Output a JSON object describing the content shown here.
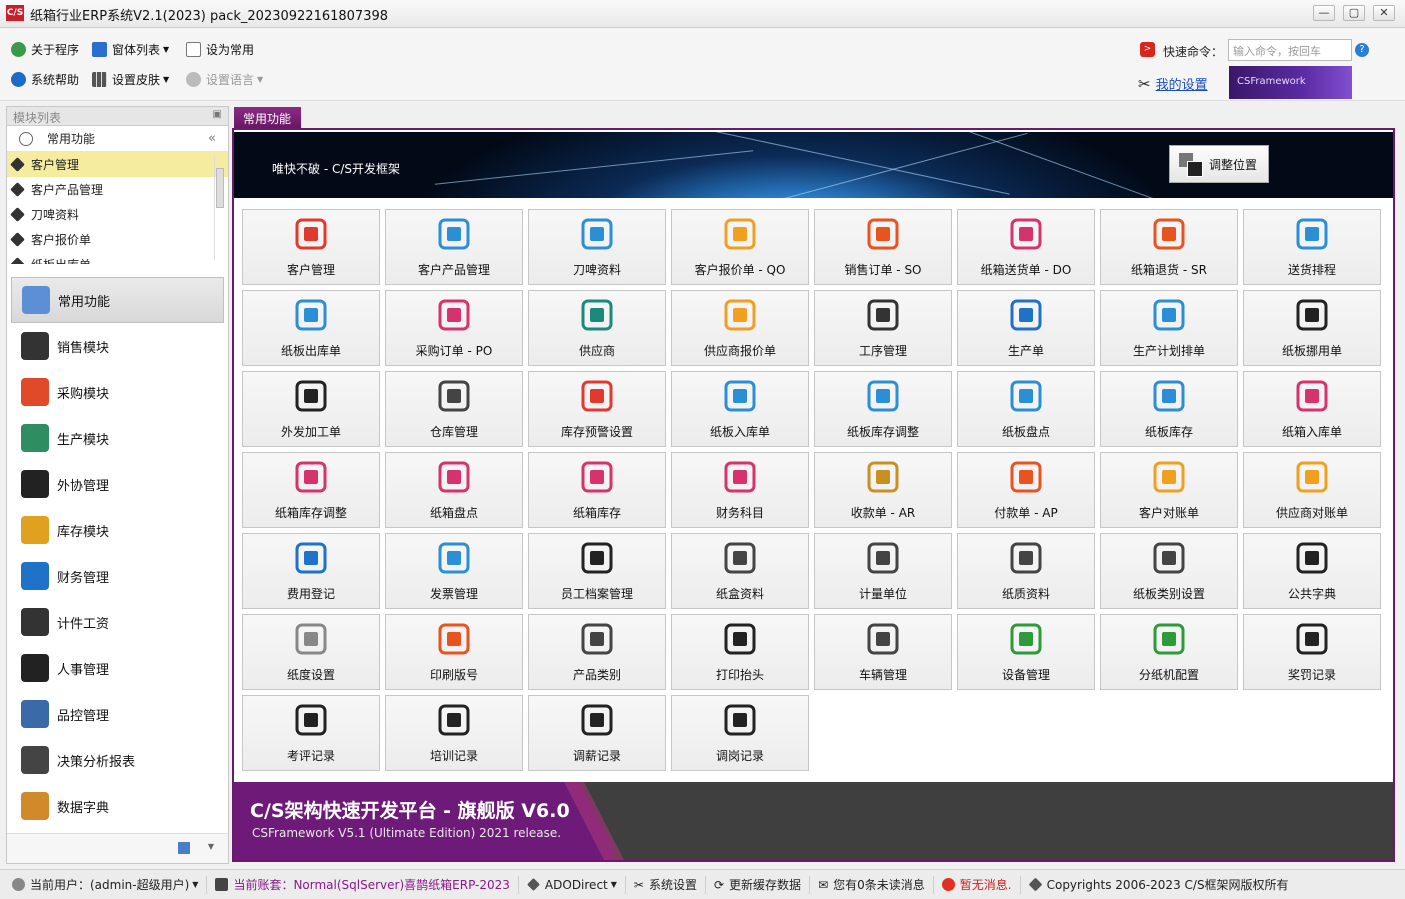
{
  "window": {
    "title": "纸箱行业ERP系统V2.1(2023) pack_20230922161807398",
    "logo": "C/S",
    "controls": {
      "minimize": "—",
      "restore": "▢",
      "close": "✕"
    }
  },
  "toolbar": {
    "about": "关于程序",
    "window_list": "窗体列表",
    "set_common": "设为常用",
    "help": "系统帮助",
    "skin": "设置皮肤",
    "language": "设置语言",
    "quick_command_label": "快速命令：",
    "quick_command_placeholder": "输入命令，按回车",
    "my_settings": "我的设置",
    "brand_banner": "CSFramework"
  },
  "left_panel": {
    "title": "模块列表",
    "common_header": "常用功能",
    "module_items": [
      "客户管理",
      "客户产品管理",
      "刀啤资料",
      "客户报价单",
      "纸板出库单"
    ],
    "selected_index": 0,
    "nav": [
      {
        "label": "常用功能",
        "icon": "user-icon",
        "color": "#5b8fd6"
      },
      {
        "label": "销售模块",
        "icon": "org-chart-icon",
        "color": "#333333"
      },
      {
        "label": "采购模块",
        "icon": "cart-icon",
        "color": "#e04a2a"
      },
      {
        "label": "生产模块",
        "icon": "money-chart-icon",
        "color": "#2f8d62"
      },
      {
        "label": "外协管理",
        "icon": "house-icon",
        "color": "#222222"
      },
      {
        "label": "库存模块",
        "icon": "coins-icon",
        "color": "#e0a020"
      },
      {
        "label": "财务管理",
        "icon": "windows-icon",
        "color": "#1e72c8"
      },
      {
        "label": "计件工资",
        "icon": "database-icon",
        "color": "#333333"
      },
      {
        "label": "人事管理",
        "icon": "tools-icon",
        "color": "#222222"
      },
      {
        "label": "品控管理",
        "icon": "spreadsheet-search-icon",
        "color": "#3a6aa8"
      },
      {
        "label": "决策分析报表",
        "icon": "grid-gear-icon",
        "color": "#444444"
      },
      {
        "label": "数据字典",
        "icon": "color-grid-icon",
        "color": "#d08a2a"
      }
    ]
  },
  "workspace": {
    "tab": "常用功能",
    "hero_text": "唯快不破 - C/S开发框架",
    "adjust_button": "调整位置",
    "tiles": [
      {
        "label": "客户管理",
        "icon": "users-icon",
        "color": "#e0392e"
      },
      {
        "label": "客户产品管理",
        "icon": "box-gear-icon",
        "color": "#2a8fd4"
      },
      {
        "label": "刀啤资料",
        "icon": "machine-icon",
        "color": "#2a8fd4"
      },
      {
        "label": "客户报价单 - QO",
        "icon": "dollar-doc-icon",
        "color": "#f0a020"
      },
      {
        "label": "销售订单 - SO",
        "icon": "clipboard-check-icon",
        "color": "#e8531e"
      },
      {
        "label": "纸箱送货单 - DO",
        "icon": "truck-icon",
        "color": "#d6336c"
      },
      {
        "label": "纸箱退货 - SR",
        "icon": "return-doc-icon",
        "color": "#e8531e"
      },
      {
        "label": "送货排程",
        "icon": "schedule-icon",
        "color": "#2a8fd4"
      },
      {
        "label": "纸板出库单",
        "icon": "warehouse-out-icon",
        "color": "#2a8fd4"
      },
      {
        "label": "采购订单 - PO",
        "icon": "purchase-order-icon",
        "color": "#d6336c"
      },
      {
        "label": "供应商",
        "icon": "supplier-icon",
        "color": "#1a8a7a"
      },
      {
        "label": "供应商报价单",
        "icon": "dollar-doc-icon",
        "color": "#f0a020"
      },
      {
        "label": "工序管理",
        "icon": "process-cube-icon",
        "color": "#333333"
      },
      {
        "label": "生产单",
        "icon": "production-eye-icon",
        "color": "#1e72c8"
      },
      {
        "label": "生产计划排单",
        "icon": "plan-icon",
        "color": "#2a8fd4"
      },
      {
        "label": "纸板挪用单",
        "icon": "swap-arrows-icon",
        "color": "#222222"
      },
      {
        "label": "外发加工单",
        "icon": "copy-doc-icon",
        "color": "#222222"
      },
      {
        "label": "仓库管理",
        "icon": "warehouse-icon",
        "color": "#444444"
      },
      {
        "label": "库存预警设置",
        "icon": "alert-house-icon",
        "color": "#e0392e"
      },
      {
        "label": "纸板入库单",
        "icon": "warehouse-in-icon",
        "color": "#2a8fd4"
      },
      {
        "label": "纸板库存调整",
        "icon": "stock-adjust-icon",
        "color": "#2a8fd4"
      },
      {
        "label": "纸板盘点",
        "icon": "stock-check-icon",
        "color": "#2a8fd4"
      },
      {
        "label": "纸板库存",
        "icon": "stock-stack-icon",
        "color": "#2a8fd4"
      },
      {
        "label": "纸箱入库单",
        "icon": "carton-in-icon",
        "color": "#d6336c"
      },
      {
        "label": "纸箱库存调整",
        "icon": "carton-adjust-icon",
        "color": "#d6336c"
      },
      {
        "label": "纸箱盘点",
        "icon": "carton-check-icon",
        "color": "#d6336c"
      },
      {
        "label": "纸箱库存",
        "icon": "boxes-icon",
        "color": "#d6336c"
      },
      {
        "label": "财务科目",
        "icon": "finance-list-icon",
        "color": "#d6336c"
      },
      {
        "label": "收款单 - AR",
        "icon": "money-bag-icon",
        "color": "#c89020"
      },
      {
        "label": "付款单 - AP",
        "icon": "payment-icon",
        "color": "#e8531e"
      },
      {
        "label": "客户对账单",
        "icon": "receipt-icon",
        "color": "#f0a020"
      },
      {
        "label": "供应商对账单",
        "icon": "receipt-icon",
        "color": "#f0a020"
      },
      {
        "label": "费用登记",
        "icon": "expense-icon",
        "color": "#1e72c8"
      },
      {
        "label": "发票管理",
        "icon": "invoice-icon",
        "color": "#2a8fd4"
      },
      {
        "label": "员工档案管理",
        "icon": "employees-icon",
        "color": "#222222"
      },
      {
        "label": "纸盒资料",
        "icon": "open-box-icon",
        "color": "#444444"
      },
      {
        "label": "计量单位",
        "icon": "ruler-pen-icon",
        "color": "#444444"
      },
      {
        "label": "纸质资料",
        "icon": "documents-icon",
        "color": "#444444"
      },
      {
        "label": "纸板类别设置",
        "icon": "layers-icon",
        "color": "#444444"
      },
      {
        "label": "公共字典",
        "icon": "network-icon",
        "color": "#222222"
      },
      {
        "label": "纸度设置",
        "icon": "gear-icon",
        "color": "#888888"
      },
      {
        "label": "印刷版号",
        "icon": "print-plate-icon",
        "color": "#e8531e"
      },
      {
        "label": "产品类别",
        "icon": "categories-icon",
        "color": "#444444"
      },
      {
        "label": "打印抬头",
        "icon": "text-t-icon",
        "color": "#222222"
      },
      {
        "label": "车辆管理",
        "icon": "vehicle-icon",
        "color": "#444444"
      },
      {
        "label": "设备管理",
        "icon": "equipment-icon",
        "color": "#2f9a3a"
      },
      {
        "label": "分纸机配置",
        "icon": "film-strip-icon",
        "color": "#2f9a3a"
      },
      {
        "label": "奖罚记录",
        "icon": "certificate-icon",
        "color": "#222222"
      },
      {
        "label": "考评记录",
        "icon": "certificate-icon",
        "color": "#222222"
      },
      {
        "label": "培训记录",
        "icon": "certificate-icon",
        "color": "#222222"
      },
      {
        "label": "调薪记录",
        "icon": "certificate-icon",
        "color": "#222222"
      },
      {
        "label": "调岗记录",
        "icon": "certificate-icon",
        "color": "#222222"
      }
    ],
    "footer_title": "C/S架构快速开发平台 - 旗舰版 V6.0",
    "footer_subtitle": "CSFramework V5.1 (Ultimate Edition) 2021 release."
  },
  "statusbar": {
    "user": "当前用户：(admin-超级用户)",
    "account": "当前账套：Normal(SqlServer)喜鹊纸箱ERP-2023",
    "connection": "ADODirect",
    "settings": "系统设置",
    "refresh_cache": "更新缓存数据",
    "messages": "您有0条未读消息",
    "notice": "暂无消息.",
    "copyright": "Copyrights 2006-2023 C/S框架网版权所有"
  }
}
